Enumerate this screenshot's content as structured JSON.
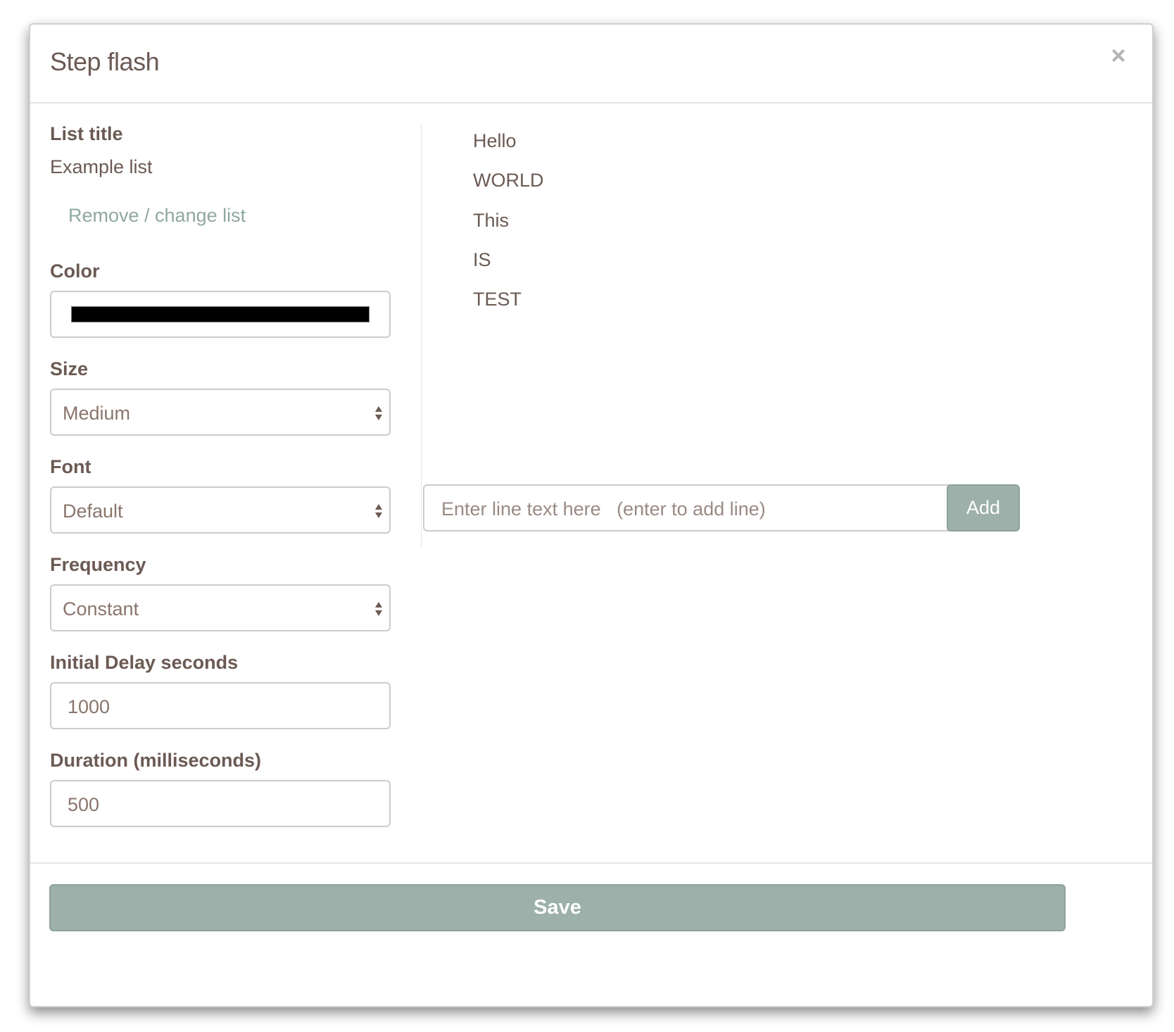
{
  "modal": {
    "title": "Step flash",
    "close_glyph": "×"
  },
  "list": {
    "title_label": "List title",
    "title_value": "Example list",
    "change_link": "Remove / change list"
  },
  "color": {
    "label": "Color",
    "value": "#000000"
  },
  "size": {
    "label": "Size",
    "selected": "Medium"
  },
  "font": {
    "label": "Font",
    "selected": "Default"
  },
  "frequency": {
    "label": "Frequency",
    "selected": "Constant"
  },
  "initial_delay": {
    "label": "Initial Delay seconds",
    "value": "1000"
  },
  "duration": {
    "label": "Duration (milliseconds)",
    "value": "500"
  },
  "lines": [
    "Hello",
    "WORLD",
    "This",
    "IS",
    "TEST"
  ],
  "line_input": {
    "placeholder": "Enter line text here   (enter to add line)"
  },
  "add_button": "Add",
  "save_button": "Save",
  "colors": {
    "button_bg": "#9db0aa",
    "link": "#8fa8a0",
    "text": "#6b5a53"
  }
}
